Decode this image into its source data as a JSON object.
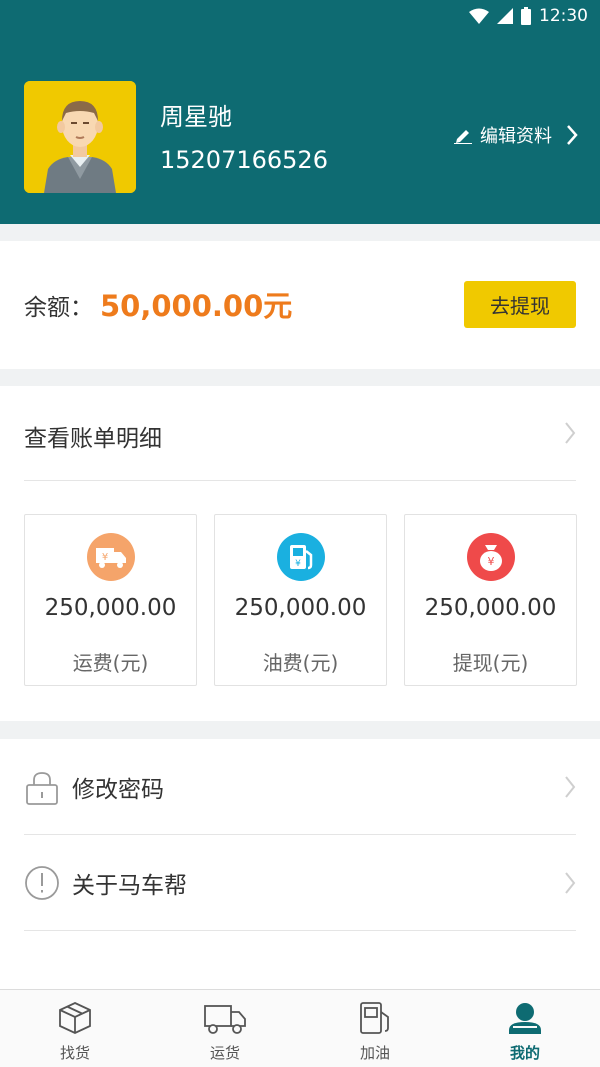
{
  "status_bar": {
    "time": "12:30"
  },
  "profile": {
    "name": "周星驰",
    "phone": "15207166526",
    "edit_label": "编辑资料"
  },
  "balance": {
    "label": "余额：",
    "amount": "50,000.00元",
    "withdraw_button": "去提现"
  },
  "bills": {
    "title": "查看账单明细",
    "stats": [
      {
        "value": "250,000.00",
        "label": "运费(元)",
        "icon": "freight-truck-icon",
        "color": "#f5a46a"
      },
      {
        "value": "250,000.00",
        "label": "油费(元)",
        "icon": "fuel-pump-icon",
        "color": "#1ab0e0"
      },
      {
        "value": "250,000.00",
        "label": "提现(元)",
        "icon": "money-bag-icon",
        "color": "#ef4a4a"
      }
    ]
  },
  "menu": [
    {
      "label": "修改密码",
      "icon": "lock-icon"
    },
    {
      "label": "关于马车帮",
      "icon": "info-icon"
    }
  ],
  "tabs": [
    {
      "label": "找货",
      "icon": "box-icon",
      "active": false
    },
    {
      "label": "运货",
      "icon": "truck-icon",
      "active": false
    },
    {
      "label": "加油",
      "icon": "gas-station-icon",
      "active": false
    },
    {
      "label": "我的",
      "icon": "user-icon",
      "active": true
    }
  ],
  "colors": {
    "primary": "#0e6b72",
    "accent": "#f0c900",
    "amount": "#ee7b1c"
  }
}
